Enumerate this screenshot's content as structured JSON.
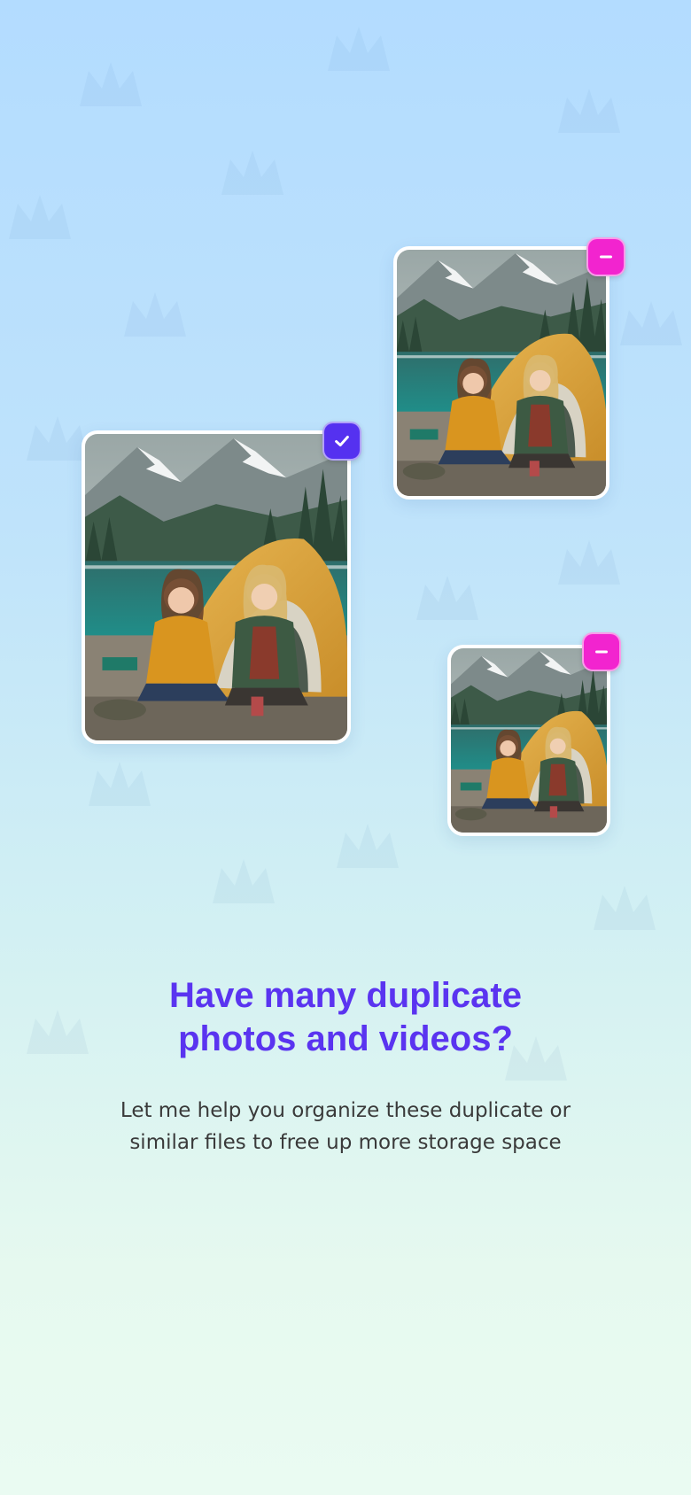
{
  "heading": {
    "line1": "Have many duplicate",
    "line2": "photos and videos?"
  },
  "description": {
    "line1": "Let me help you organize these duplicate or",
    "line2": "similar files to free up more storage space"
  },
  "photos": [
    {
      "name": "photo-main",
      "status": "selected",
      "icon": "check-icon"
    },
    {
      "name": "photo-duplicate-1",
      "status": "unselected",
      "icon": "minus-icon"
    },
    {
      "name": "photo-duplicate-2",
      "status": "unselected",
      "icon": "minus-icon"
    }
  ],
  "colors": {
    "accent_purple": "#5a34f0",
    "selected_badge": "#5531f0",
    "unselected_badge": "#f224cf"
  }
}
